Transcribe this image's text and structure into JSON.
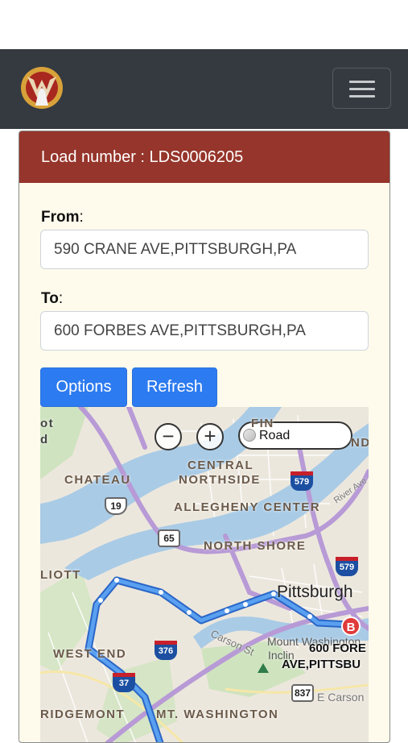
{
  "navbar": {
    "logo_icon": "wolf-logo-icon",
    "menu_icon": "hamburger-menu-icon",
    "background": "#343a40"
  },
  "load": {
    "header": "Load number : LDS0006205",
    "header_color": "#96352b"
  },
  "form": {
    "from_label": "From",
    "from_value": "590 CRANE AVE,PITTSBURGH,PA",
    "to_label": "To",
    "to_value": "600 FORBES AVE,PITTSBURGH,PA"
  },
  "buttons": {
    "options": "Options",
    "refresh": "Refresh",
    "color": "#2d7bf0"
  },
  "map": {
    "zoom_out": "−",
    "zoom_in": "+",
    "map_type": "Road",
    "labels": {
      "top_left_1": "ot",
      "top_left_2": "d",
      "chateau": "CHATEAU",
      "central_northside_1": "CENTRAL",
      "central_northside_2": "NORTHSIDE",
      "allegheny_center": "ALLEGHENY CENTER",
      "north_shore": "NORTH SHORE",
      "elliott": "LIOTT",
      "pittsburgh": "Pittsburgh",
      "west_end": "WEST END",
      "mount_washington_area": "Mount Washington",
      "ridgemont": "RIDGEMONT",
      "mt_washington": "MT. WASHINGTON",
      "carson_st": "Carson St",
      "e_carson": "E Carson",
      "river_ave": "River Ave",
      "fin": "FIN",
      "nd": "ND",
      "inclin": "Inclin"
    },
    "shields": {
      "us19": "19",
      "r65": "65",
      "i579_top": "579",
      "i579_mid": "579",
      "i376": "376",
      "i37": "37",
      "r837": "837"
    },
    "destination_pin": "B",
    "destination_label_1": "600 FORE",
    "destination_label_2": "AVE,PITTSBU",
    "route_color": "#3b86e8"
  }
}
